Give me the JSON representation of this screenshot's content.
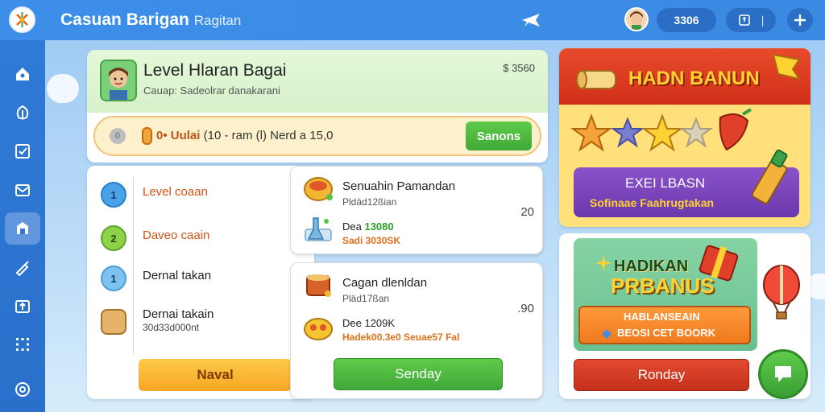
{
  "header": {
    "title": "Casuan Barigan",
    "subtitle": "Ragitan",
    "coins": "3306"
  },
  "sidebar": {
    "items": [
      "home-icon",
      "leaf-icon",
      "checklist-icon",
      "mail-icon",
      "shop-icon",
      "brush-icon",
      "upload-icon",
      "grid-icon",
      "badge-icon"
    ]
  },
  "level": {
    "title": "Level Hlaran Bagai",
    "subtitle": "Cauap: Sadeolrar danakarani",
    "coins": "$ 3560",
    "progress_num": "0",
    "progress_strong": "0• Uulai",
    "progress_text": "(10 - ram  (l)   Nerd a 15,0",
    "save_label": "Sanons"
  },
  "list": {
    "items": [
      {
        "badge": "1",
        "label": "Level coaan",
        "sub": ""
      },
      {
        "badge": "2",
        "label": "Daveo caain",
        "sub": ""
      },
      {
        "badge": "1",
        "label": "Dernal takan",
        "sub": ""
      },
      {
        "badge": "",
        "label": "Dernai takain",
        "sub": "30d33d000nt"
      }
    ],
    "button": "Naval"
  },
  "offers": [
    {
      "title": "Senuahin Pamandan",
      "sub": "Pldäd12ßian",
      "price_prefix": "Dea ",
      "price": "13080",
      "sub2": "Sadi 3030SK",
      "num": "20"
    },
    {
      "title": "Cagan dlenldan",
      "sub": "Pläd17ßan",
      "price_prefix": "Dee ",
      "price": "1209K",
      "sub2": "Hadek00.3e0 Seuae57 Fal",
      "num": ".90"
    }
  ],
  "send_button": "Senday",
  "promo_top": {
    "banner": "HADN BANUN",
    "purple_title": "EXEI LBASN",
    "purple_sub": "Sofinaae Faahrugtakan"
  },
  "promo_bottom": {
    "title1": "HADIKAN",
    "title2": "PRBANUS",
    "orange1": "HABLANSEAIN",
    "orange2": "BEOSI CET BOORK",
    "button": "Ronday"
  },
  "colors": {
    "topbar": "#3d8ee8",
    "sidebar": "#2f7ad6",
    "green": "#3fa837",
    "orange": "#f6a623",
    "red": "#c4301c"
  }
}
